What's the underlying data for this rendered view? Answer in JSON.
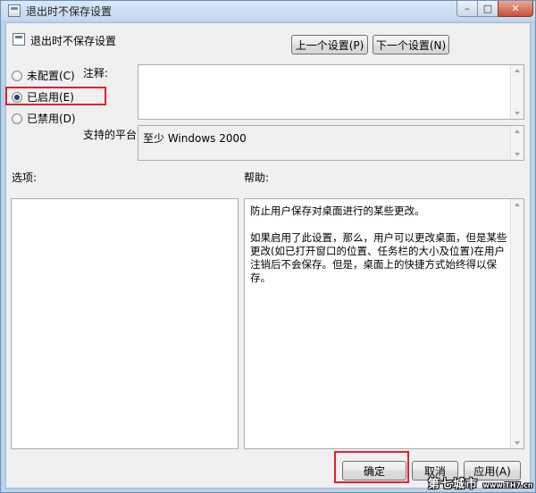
{
  "window": {
    "title": "退出时不保存设置",
    "controls": {
      "minimize": "–",
      "maximize": "□",
      "close": "✕"
    }
  },
  "header": {
    "setting_name": "退出时不保存设置",
    "prev_button": "上一个设置(P)",
    "next_button": "下一个设置(N)"
  },
  "state": {
    "options": [
      {
        "label": "未配置(C)",
        "checked": false
      },
      {
        "label": "已启用(E)",
        "checked": true
      },
      {
        "label": "已禁用(D)",
        "checked": false
      }
    ]
  },
  "comment": {
    "label": "注释:",
    "value": ""
  },
  "platform": {
    "label": "支持的平台:",
    "value": "至少 Windows 2000"
  },
  "options_panel": {
    "label": "选项:"
  },
  "help_panel": {
    "label": "帮助:",
    "paragraphs": [
      "防止用户保存对桌面进行的某些更改。",
      "如果启用了此设置，那么，用户可以更改桌面，但是某些更改(如已打开窗口的位置、任务栏的大小及位置)在用户注销后不会保存。但是，桌面上的快捷方式始终得以保存。"
    ]
  },
  "footer": {
    "ok_button": "确定",
    "cancel_button": "取消",
    "apply_button": "应用(A)"
  },
  "watermark": {
    "text": "第七城市",
    "small": "www.TH7.cn"
  },
  "colors": {
    "highlight": "#e0202a",
    "title_bar": "#c2d7ee"
  }
}
